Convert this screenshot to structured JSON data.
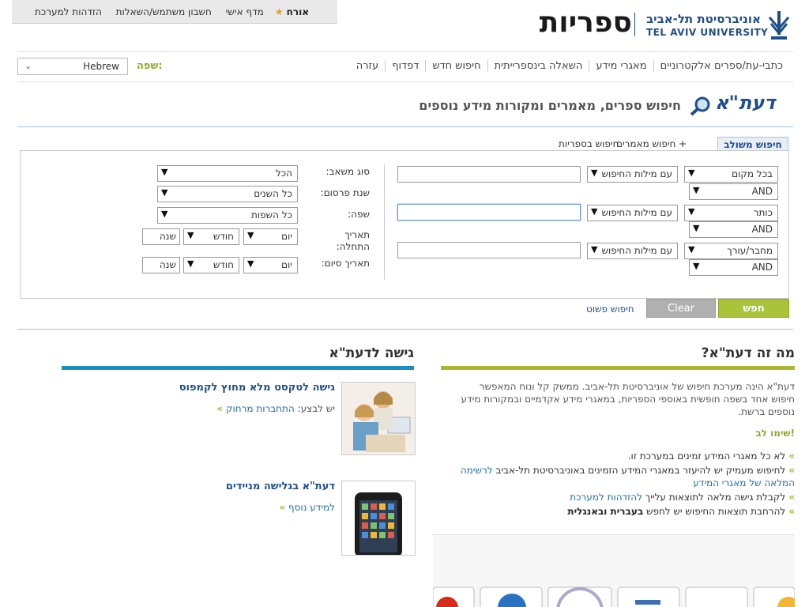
{
  "userbar": {
    "guest": "אורח",
    "links": [
      "מדף אישי",
      "חשבון משתמש/השאלות",
      "הזדהות למערכת"
    ]
  },
  "brand": {
    "sifriyot": "ספריות",
    "univ_he": "אוניברסיטת תל-אביב",
    "univ_en": "TEL AVIV UNIVERSITY"
  },
  "nav": {
    "items": [
      "כתבי-עת/ספרים אלקטרוניים",
      "מאגרי מידע",
      "השאלה בינספרייתית",
      "חיפוש חדש",
      "דפדוף",
      "עזרה"
    ],
    "lang_label": "שפה:",
    "lang_value": "Hebrew"
  },
  "daat": {
    "logo": "דעת\"א",
    "title": "חיפוש ספרים, מאמרים ומקורות מידע נוספים"
  },
  "tabs": {
    "combined": "חיפוש משולב",
    "articles": "חיפוש מאמרים +",
    "library": "חיפוש בספריות"
  },
  "search": {
    "rows": [
      {
        "field": "בכל מקום",
        "mode": "עם מילות החיפוש",
        "op": "AND"
      },
      {
        "field": "כותר",
        "mode": "עם מילות החיפוש",
        "op": "AND"
      },
      {
        "field": "מחבר/עורך",
        "mode": "עם מילות החיפוש",
        "op": "AND"
      }
    ],
    "filters": {
      "resource_label": "סוג משאב:",
      "resource_value": "הכל",
      "year_label": "שנת פרסום:",
      "year_value": "כל השנים",
      "lang_label": "שפה:",
      "lang_value": "כל השפות",
      "start_label": "תאריך התחלה:",
      "end_label": "תאריך סיום:",
      "day": "יום",
      "month": "חודש",
      "year_ph": "שנה"
    },
    "search_btn": "חפש",
    "clear_btn": "Clear",
    "simple_link": "חיפוש פשוט"
  },
  "about": {
    "title": "מה זה דעת\"א?",
    "para": "דעת\"א הינה מערכת חיפוש של אוניברסיטת תל-אביב. ממשק קל ונוח המאפשר חיפוש אחד בשפה חופשית באוספי הספריות, במאגרי מידע אקדמיים ובמקורות מידע נוספים ברשת.",
    "notice": "שימו לב!",
    "bullet1": "לא כל מאגרי המידע זמינים במערכת זו.",
    "bullet2_a": "לחיפוש מעמיק יש להיעזר במאגרי המידע הזמינים באוניברסיטת תל-אביב ",
    "bullet2_link": "לרשימה המלאה של מאגרי המידע",
    "bullet3_a": "לקבלת גישה מלאה לתוצאות עלייך ",
    "bullet3_link": "להזדהות למערכת",
    "bullet4_a": "להרחבת תוצאות החיפוש יש לחפש ",
    "bullet4_b": "בעברית ובאנגלית"
  },
  "access": {
    "title": "גישה לדעת\"א",
    "card1_title": "גישה לטקסט מלא מחוץ לקמפוס",
    "card1_pre": "יש לבצע: ",
    "card1_link": "התחברות מרחוק",
    "card2_title": "דעת\"א בגלישה מניידים",
    "card2_link": "למידע נוסף"
  },
  "colors": {
    "accent_green": "#a9c43a",
    "accent_blue": "#1a8fc0",
    "brand_blue": "#1f4e8c"
  }
}
